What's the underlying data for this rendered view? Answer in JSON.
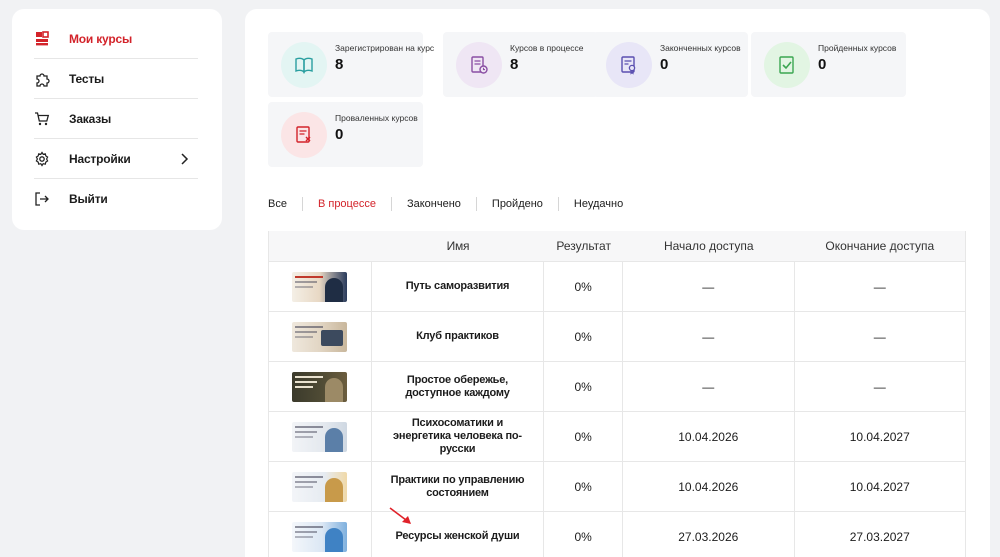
{
  "sidebar": {
    "items": [
      {
        "label": "Мои курсы",
        "icon": "my-courses-icon",
        "active": true
      },
      {
        "label": "Тесты",
        "icon": "puzzle-icon",
        "active": false
      },
      {
        "label": "Заказы",
        "icon": "cart-icon",
        "active": false
      },
      {
        "label": "Настройки",
        "icon": "gear-icon",
        "active": false
      },
      {
        "label": "Выйти",
        "icon": "logout-icon",
        "active": false
      }
    ]
  },
  "stats": [
    {
      "label": "Зарегистрирован на курс",
      "value": "8",
      "icon": "open-book-icon",
      "color": "#e3f5f3"
    },
    {
      "label": "Курсов в процессе",
      "value": "8",
      "icon": "document-clock-icon",
      "color": "#efe6f4"
    },
    {
      "label": "Законченных курсов",
      "value": "0",
      "icon": "certificate-icon",
      "color": "#e8e6f7"
    },
    {
      "label": "Пройденных курсов",
      "value": "0",
      "icon": "checklist-icon",
      "color": "#e2f5e3"
    },
    {
      "label": "Проваленных курсов",
      "value": "0",
      "icon": "failed-document-icon",
      "color": "#fbe5e6"
    }
  ],
  "tabs": [
    {
      "label": "Все",
      "active": false
    },
    {
      "label": "В процессе",
      "active": true
    },
    {
      "label": "Закончено",
      "active": false
    },
    {
      "label": "Пройдено",
      "active": false
    },
    {
      "label": "Неудачно",
      "active": false
    }
  ],
  "table": {
    "headers": {
      "name": "Имя",
      "result": "Результат",
      "start": "Начало доступа",
      "end": "Окончание доступа"
    },
    "rows": [
      {
        "name": "Путь саморазвития",
        "result": "0%",
        "start": "—",
        "end": "—"
      },
      {
        "name": "Клуб практиков",
        "result": "0%",
        "start": "—",
        "end": "—"
      },
      {
        "name": "Простое обережье, доступное каждому",
        "result": "0%",
        "start": "—",
        "end": "—"
      },
      {
        "name": "Психосоматики и энергетика человека по-русски",
        "result": "0%",
        "start": "10.04.2026",
        "end": "10.04.2027"
      },
      {
        "name": "Практики по управлению состоянием",
        "result": "0%",
        "start": "10.04.2026",
        "end": "10.04.2027"
      },
      {
        "name": "Ресурсы женской души",
        "result": "0%",
        "start": "27.03.2026",
        "end": "27.03.2027"
      }
    ]
  },
  "colors": {
    "accent": "#d3232a",
    "arrow": "#e0222a"
  }
}
